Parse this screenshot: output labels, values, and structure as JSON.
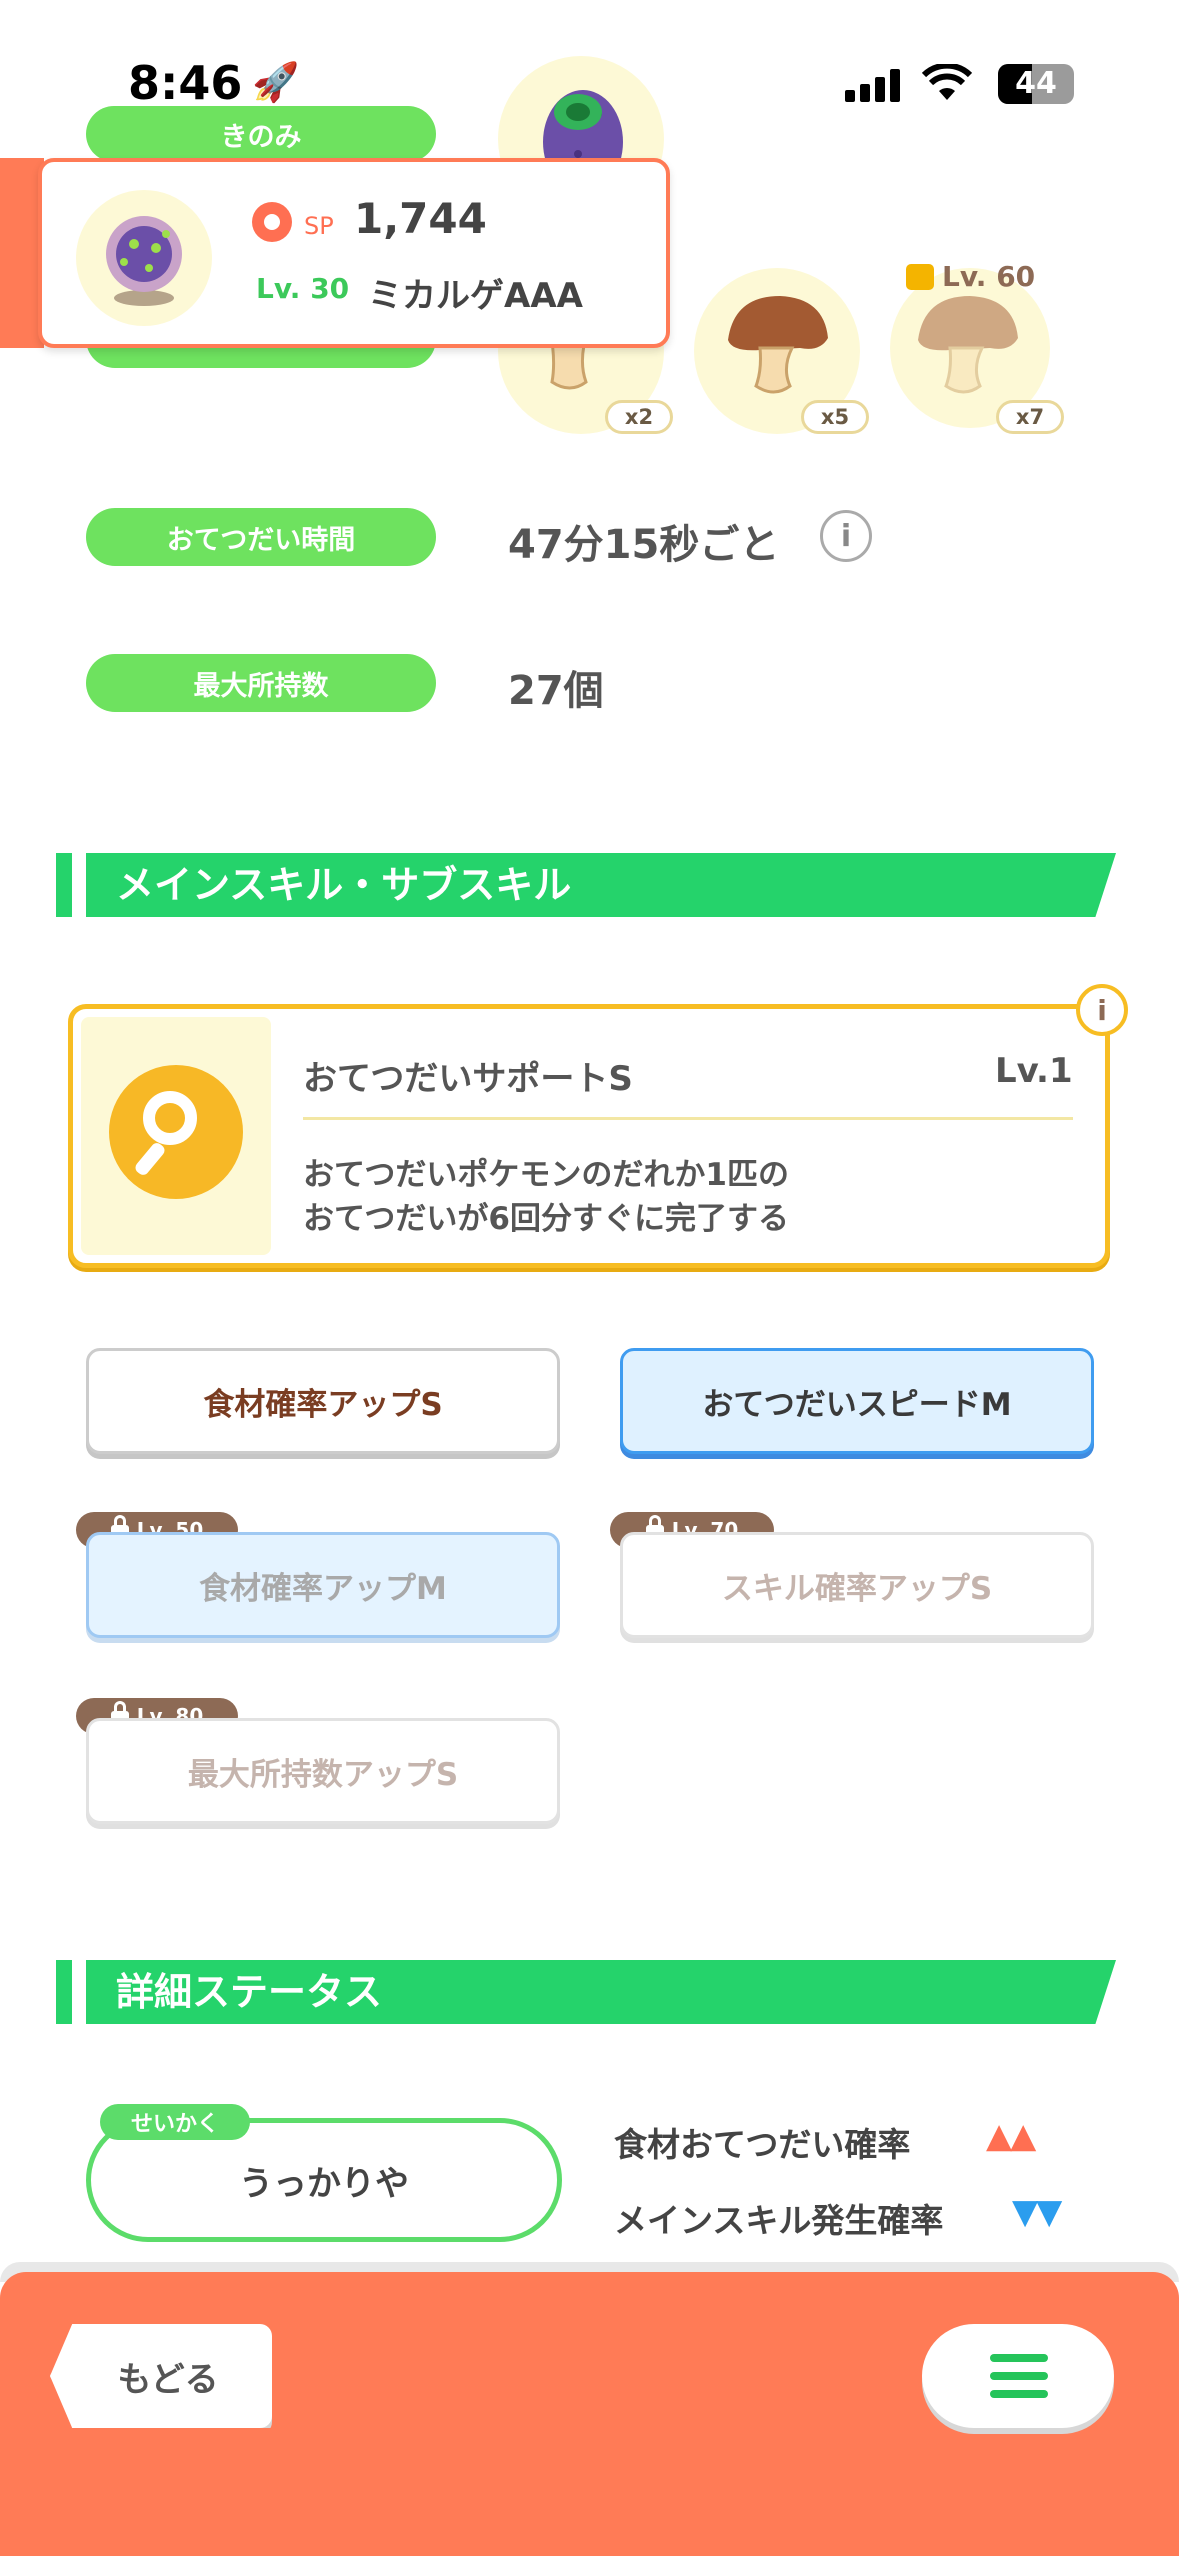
{
  "status_bar": {
    "time": "8:46",
    "battery": "44"
  },
  "berry": {
    "label": "きのみ"
  },
  "ingredients": {
    "counts": [
      "x2",
      "x5",
      "x7"
    ],
    "lock_level": "Lv. 60"
  },
  "popup": {
    "sp_label": "SP",
    "sp_value": "1,744",
    "level": "Lv. 30",
    "name": "ミカルゲAAA"
  },
  "help_time": {
    "label": "おてつだい時間",
    "value": "47分15秒ごと"
  },
  "max_carry": {
    "label": "最大所持数",
    "value": "27個"
  },
  "skills_section": {
    "title": "メインスキル・サブスキル"
  },
  "main_skill": {
    "name": "おてつだいサポートS",
    "level": "Lv.1",
    "desc_line1": "おてつだいポケモンのだれか1匹の",
    "desc_line2": "おてつだいが6回分すぐに完了する"
  },
  "sub_skills": [
    {
      "label": "食材確率アップS"
    },
    {
      "label": "おてつだいスピードM"
    },
    {
      "label": "食材確率アップM",
      "lock": "Lv. 50"
    },
    {
      "label": "スキル確率アップS",
      "lock": "Lv. 70"
    },
    {
      "label": "最大所持数アップS",
      "lock": "Lv. 80"
    }
  ],
  "detail_section": {
    "title": "詳細ステータス"
  },
  "nature": {
    "tag": "せいかく",
    "value": "うっかりや"
  },
  "effects": [
    {
      "label": "食材おてつだい確率",
      "arrows": "▲▲",
      "color": "#ff6f52"
    },
    {
      "label": "メインスキル発生確率",
      "arrows": "▼▼",
      "color": "#2b9dee"
    }
  ],
  "bottom": {
    "back_label": "もどる"
  },
  "colors": {
    "green": "#6ee25f",
    "section_green": "#25d36b",
    "footer": "#ff7b56"
  }
}
